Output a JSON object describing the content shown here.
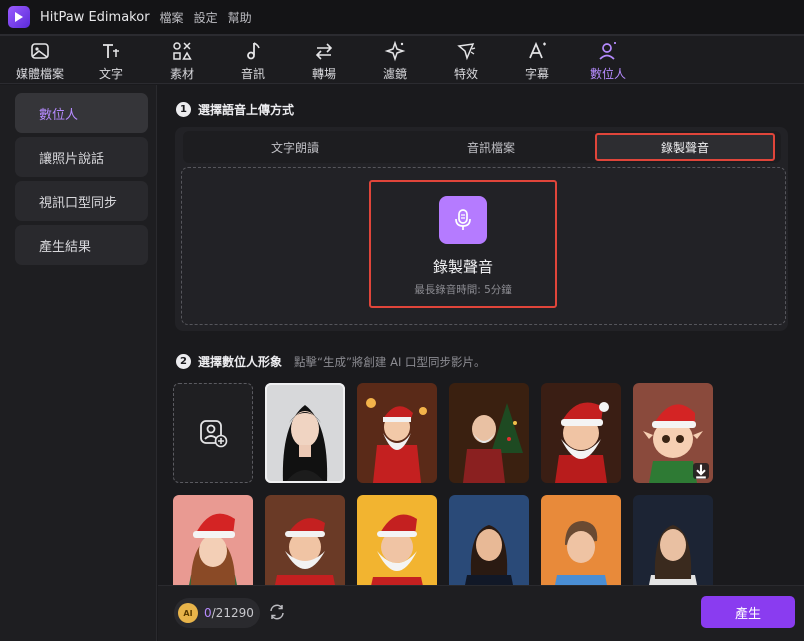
{
  "app": {
    "name": "HitPaw Edimakor"
  },
  "menu": [
    "檔案",
    "設定",
    "幫助"
  ],
  "toolbar": [
    {
      "label": "媒體檔案",
      "icon": "media-icon"
    },
    {
      "label": "文字",
      "icon": "text-icon"
    },
    {
      "label": "素材",
      "icon": "elements-icon"
    },
    {
      "label": "音訊",
      "icon": "audio-icon"
    },
    {
      "label": "轉場",
      "icon": "transition-icon"
    },
    {
      "label": "濾鏡",
      "icon": "filter-icon"
    },
    {
      "label": "特效",
      "icon": "effects-icon"
    },
    {
      "label": "字幕",
      "icon": "subtitle-icon"
    },
    {
      "label": "數位人",
      "icon": "digital-human-icon",
      "active": true
    }
  ],
  "sidebar": {
    "items": [
      {
        "label": "數位人",
        "active": true
      },
      {
        "label": "讓照片說話"
      },
      {
        "label": "視訊口型同步"
      },
      {
        "label": "產生結果"
      }
    ]
  },
  "step1": {
    "number": "1",
    "title": "選擇語音上傳方式",
    "tabs": [
      "文字朗讀",
      "音訊檔案",
      "錄製聲音"
    ],
    "active_tab": "錄製聲音",
    "record": {
      "title": "錄製聲音",
      "subtitle": "最長錄音時間: 5分鐘"
    }
  },
  "step2": {
    "number": "2",
    "title": "選擇數位人形象",
    "hint": "點擊“生成”將創建 AI 口型同步影片。",
    "avatars": [
      {
        "name": "upload-avatar",
        "type": "add"
      },
      {
        "name": "asian-woman",
        "selected": true
      },
      {
        "name": "santa-1"
      },
      {
        "name": "old-man-christmas"
      },
      {
        "name": "santa-2"
      },
      {
        "name": "elf-cartoon",
        "download": true
      },
      {
        "name": "woman-santa-hat"
      },
      {
        "name": "santa-3"
      },
      {
        "name": "santa-4"
      },
      {
        "name": "business-woman-1"
      },
      {
        "name": "business-woman-2"
      },
      {
        "name": "news-anchor"
      }
    ]
  },
  "footer": {
    "coin_label": "AI",
    "credits_used": "0",
    "credits_total": "/21290",
    "generate_label": "產生"
  },
  "colors": {
    "accent": "#8a3cf0",
    "highlight": "#e0453a",
    "active_text": "#b68bff"
  }
}
